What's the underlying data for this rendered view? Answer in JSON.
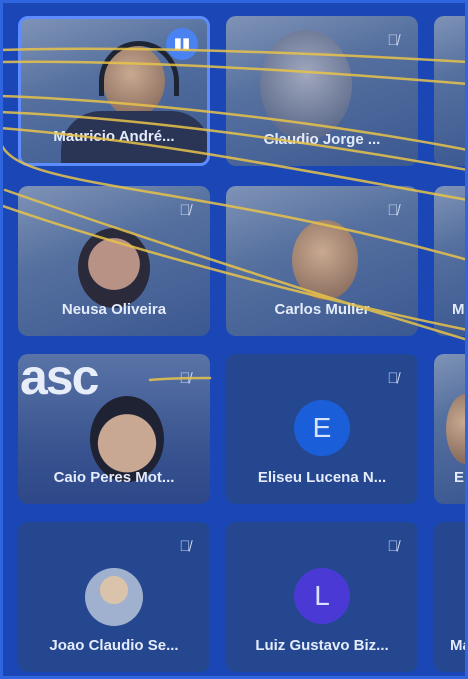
{
  "participants": [
    {
      "name": "Mauricio André...",
      "mic": "speaking",
      "active": true
    },
    {
      "name": "Claudio Jorge ...",
      "mic": "muted"
    },
    {
      "name": "Neusa Oliveira",
      "mic": "muted"
    },
    {
      "name": "Carlos Muller",
      "mic": "muted"
    },
    {
      "name": "Caio Peres Mot...",
      "mic": "muted",
      "background_text": "asc"
    },
    {
      "name": "Eliseu Lucena N...",
      "mic": "muted",
      "initial": "E",
      "avatar_color": "#1a5fd9"
    },
    {
      "name": "Joao Claudio Se...",
      "mic": "muted"
    },
    {
      "name": "Luiz Gustavo Biz...",
      "mic": "muted",
      "initial": "L",
      "avatar_color": "#4b39d6"
    }
  ],
  "partial_tiles": [
    {
      "name_fragment": "M"
    },
    {
      "name_fragment": "E"
    },
    {
      "name_fragment": "Ma"
    }
  ],
  "icons": {
    "muted": "mic-off-icon",
    "speaking": "audio-bars-icon"
  },
  "colors": {
    "background": "#1b47b6",
    "tile": "#24478f",
    "active_border": "#5c8cff",
    "annotation": "#e8c34a"
  }
}
